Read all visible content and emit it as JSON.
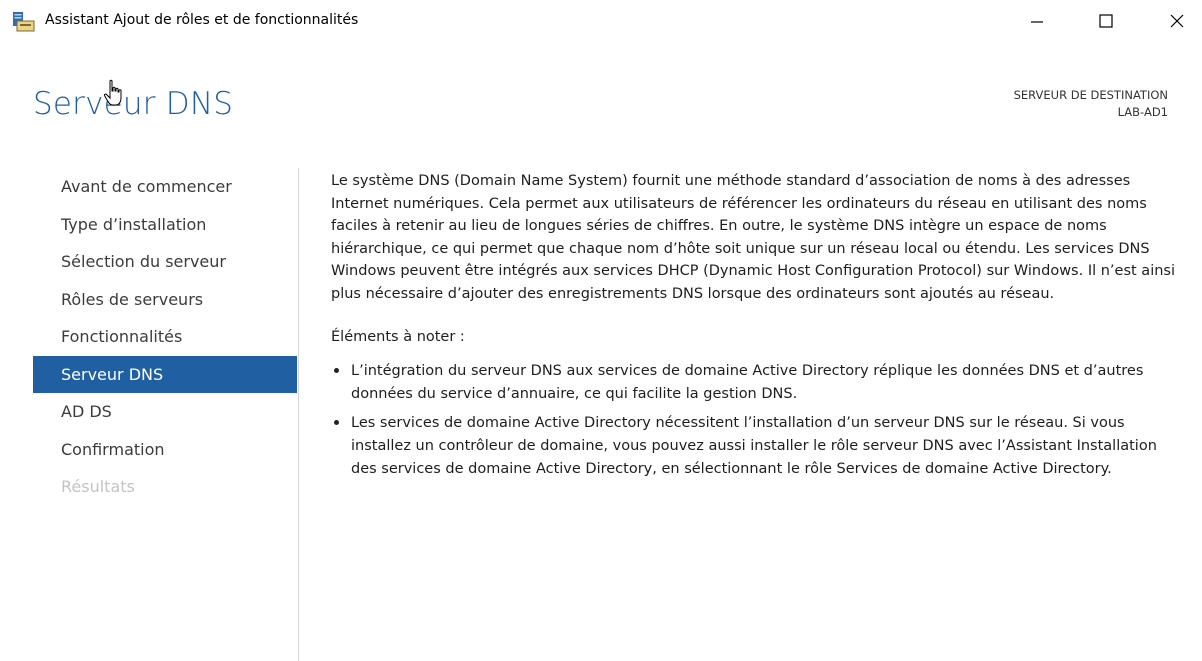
{
  "window": {
    "title": "Assistant Ajout de rôles et de fonctionnalités",
    "controls": [
      "minimize",
      "maximize",
      "close"
    ]
  },
  "header": {
    "page_title": "Serveur DNS",
    "destination_label": "SERVEUR DE DESTINATION",
    "destination_server": "LAB-AD1"
  },
  "sidebar": {
    "items": [
      {
        "label": "Avant de commencer",
        "state": "normal"
      },
      {
        "label": "Type d’installation",
        "state": "normal"
      },
      {
        "label": "Sélection du serveur",
        "state": "normal"
      },
      {
        "label": "Rôles de serveurs",
        "state": "normal"
      },
      {
        "label": "Fonctionnalités",
        "state": "normal"
      },
      {
        "label": "Serveur DNS",
        "state": "active"
      },
      {
        "label": "AD DS",
        "state": "normal"
      },
      {
        "label": "Confirmation",
        "state": "normal"
      },
      {
        "label": "Résultats",
        "state": "disabled"
      }
    ]
  },
  "main": {
    "description": "Le système DNS (Domain Name System) fournit une méthode standard d’association de noms à des adresses Internet numériques. Cela permet aux utilisateurs de référencer les ordinateurs du réseau en utilisant des noms faciles à retenir au lieu de longues séries de chiffres. En outre, le système DNS intègre un espace de noms hiérarchique, ce qui permet que chaque nom d’hôte soit unique sur un réseau local ou étendu. Les services DNS Windows peuvent être intégrés aux services DHCP (Dynamic Host Configuration Protocol) sur Windows. Il n’est ainsi plus nécessaire d’ajouter des enregistrements DNS lorsque des ordinateurs sont ajoutés au réseau.",
    "notes_heading": "Éléments à noter :",
    "notes": [
      "L’intégration du serveur DNS aux services de domaine Active Directory réplique les données DNS et d’autres données du service d’annuaire, ce qui facilite la gestion DNS.",
      "Les services de domaine Active Directory nécessitent l’installation d’un serveur DNS sur le réseau. Si vous installez un contrôleur de domaine, vous pouvez aussi installer le rôle serveur DNS avec l’Assistant Installation des services de domaine Active Directory, en sélectionnant le rôle Services de domaine Active Directory."
    ]
  },
  "colors": {
    "accent": "#1f5fa2",
    "nav_text": "#3c3c3c",
    "nav_disabled": "#c4c4c4",
    "divider": "#d8d8d8"
  },
  "icons": [
    "app-icon",
    "minimize-icon",
    "maximize-icon",
    "close-icon",
    "hand-cursor-icon"
  ]
}
